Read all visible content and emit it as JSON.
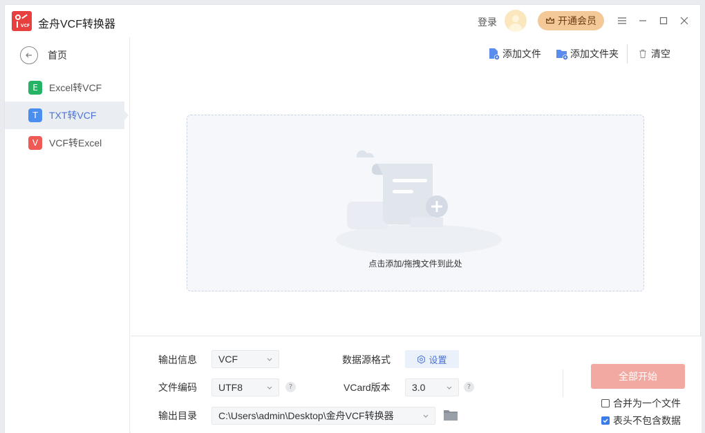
{
  "app": {
    "title": "金舟VCF转换器",
    "logo_text": "VCF"
  },
  "header": {
    "login": "登录",
    "vip_label": "开通会员"
  },
  "sidebar": {
    "home": "首页",
    "items": [
      {
        "icon_letter": "E",
        "label": "Excel转VCF",
        "color": "#25b366",
        "active": false
      },
      {
        "icon_letter": "T",
        "label": "TXT转VCF",
        "color": "#4a8ff0",
        "active": true
      },
      {
        "icon_letter": "V",
        "label": "VCF转Excel",
        "color": "#ef5a54",
        "active": false
      }
    ]
  },
  "toolbar": {
    "add_file": "添加文件",
    "add_folder": "添加文件夹",
    "clear": "清空"
  },
  "dropzone": {
    "text": "点击添加/拖拽文件到此处"
  },
  "output": {
    "info_label": "输出信息",
    "info_value": "VCF",
    "encoding_label": "文件编码",
    "encoding_value": "UTF8",
    "dir_label": "输出目录",
    "dir_value": "C:\\Users\\admin\\Desktop\\金舟VCF转换器",
    "source_format_label": "数据源格式",
    "settings_label": "设置",
    "vcard_label": "VCard版本",
    "vcard_value": "3.0",
    "help": "?"
  },
  "actions": {
    "start": "全部开始",
    "merge": "合并为一个文件",
    "merge_checked": false,
    "no_header": "表头不包含数据",
    "no_header_checked": true
  },
  "colors": {
    "accent": "#4a72d6",
    "start_button": "#f2a9a1",
    "vip": "#f3c998",
    "logo": "#e8403f"
  }
}
